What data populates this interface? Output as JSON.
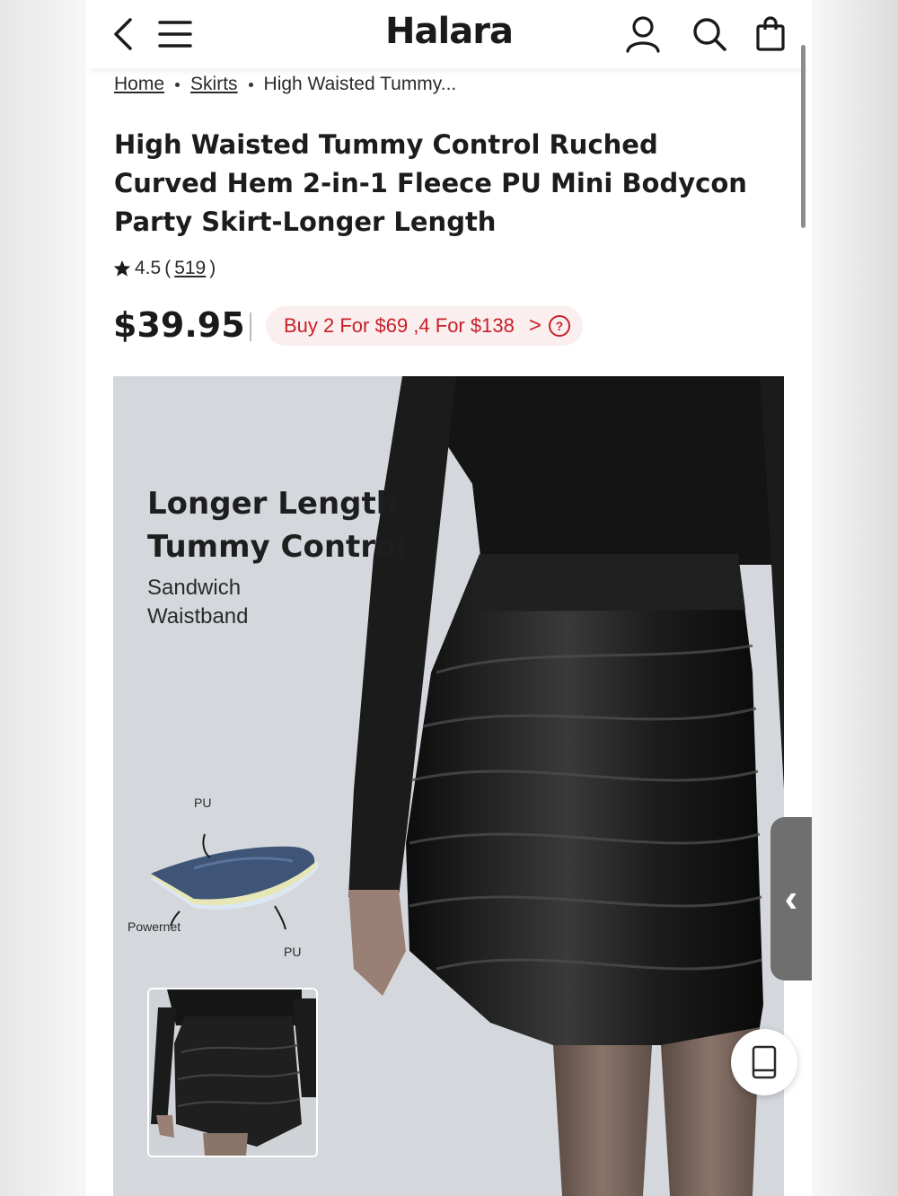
{
  "header": {
    "logo": "Halara",
    "icons": [
      "back-icon",
      "menu-icon",
      "user-icon",
      "search-icon",
      "bag-icon"
    ]
  },
  "breadcrumb": {
    "items": [
      "Home",
      "Skirts",
      "High Waisted Tummy..."
    ]
  },
  "product": {
    "title": "High Waisted Tummy Control Ruched Curved Hem 2-in-1 Fleece PU Mini Bodycon Party Skirt-Longer Length",
    "rating": "4.5",
    "review_count": "519",
    "price": "$39.95",
    "promo": "Buy 2 For $69 ,4 For $138",
    "promo_arrow": ">",
    "promo_help": "?"
  },
  "image_overlay": {
    "heading_line1": "Longer Length",
    "heading_line2": "Tummy Control",
    "sub_line1": "Sandwich",
    "sub_line2": "Waistband",
    "layer_top": "PU",
    "layer_middle": "Powernet",
    "layer_bottom": "PU"
  },
  "colors": {
    "promo_text": "#c8202a",
    "promo_bg": "#fbeeee",
    "image_bg": "#d4d8dd"
  }
}
